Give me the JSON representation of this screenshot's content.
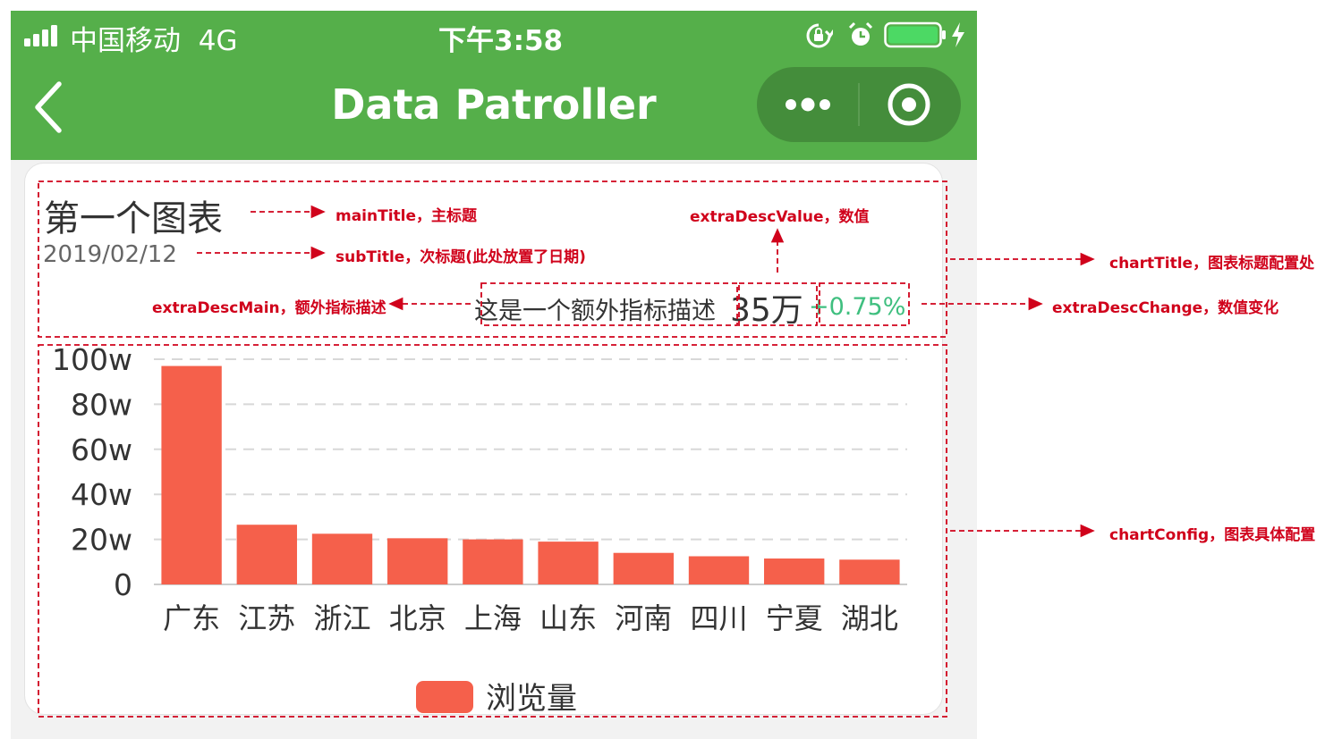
{
  "status_bar": {
    "carrier": "中国移动",
    "network": "4G",
    "time": "下午3:58"
  },
  "nav": {
    "title": "Data Patroller"
  },
  "chart_title": {
    "main_title": "第一个图表",
    "sub_title": "2019/02/12",
    "extra_desc_main": "这是一个额外指标描述",
    "extra_desc_value": "35万",
    "extra_desc_change": "+0.75%"
  },
  "annotations": {
    "main_title": "mainTitle，主标题",
    "sub_title": "subTitle，次标题(此处放置了日期)",
    "extra_desc_value": "extraDescValue，数值",
    "chart_title": "chartTitle，图表标题配置处",
    "extra_desc_main": "extraDescMain，额外指标描述",
    "extra_desc_change": "extraDescChange，数值变化",
    "chart_config": "chartConfig，图表具体配置"
  },
  "colors": {
    "nav_green": "#55af4a",
    "bar": "#f5604b",
    "change_green": "#3fbf7f",
    "annotation_red": "#d0021b"
  },
  "chart_data": {
    "type": "bar",
    "categories": [
      "广东",
      "江苏",
      "浙江",
      "北京",
      "上海",
      "山东",
      "河南",
      "四川",
      "宁夏",
      "湖北"
    ],
    "series": [
      {
        "name": "浏览量",
        "values": [
          97,
          26.5,
          22.5,
          20.5,
          20,
          19,
          14,
          12.5,
          11.5,
          11
        ]
      }
    ],
    "y_ticks": [
      "0",
      "20w",
      "40w",
      "60w",
      "80w",
      "100w"
    ],
    "ylim": [
      0,
      100
    ],
    "grid": true,
    "legend": "bottom-center"
  }
}
